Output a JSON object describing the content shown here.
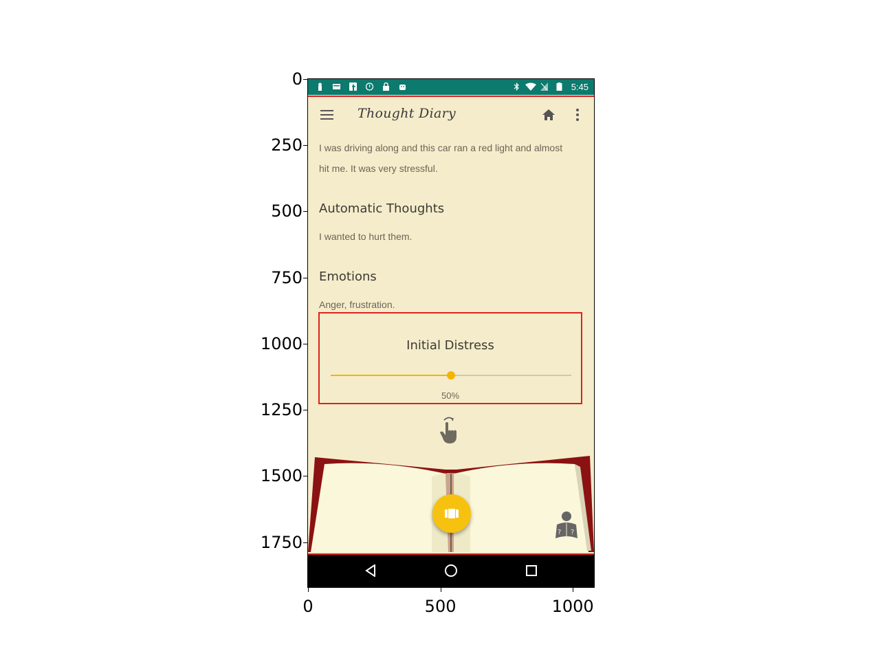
{
  "status_bar": {
    "time": "5:45",
    "color": "#0d7a6e"
  },
  "app_bar": {
    "title": "Thought Diary",
    "menu_icon": "hamburger-icon",
    "home_icon": "home-icon",
    "more_icon": "more-vert-icon"
  },
  "entry": {
    "situation": "I was driving along and this car ran a red light and almost hit me. It was very stressful.",
    "automatic_thoughts_heading": "Automatic Thoughts",
    "automatic_thoughts": "I wanted to hurt them.",
    "emotions_heading": "Emotions",
    "emotions": "Anger, frustration."
  },
  "initial_distress": {
    "label": "Initial Distress",
    "value_text": "50%",
    "value": 0.5,
    "accent": "#f4b400"
  },
  "fab": {
    "icon": "theater-icon",
    "color": "#f7c20f"
  },
  "reader_icon": "reader-question-icon",
  "axis": {
    "y_ticks": [
      "0",
      "250",
      "500",
      "750",
      "1000",
      "1250",
      "1500",
      "1750"
    ],
    "x_ticks": [
      "0",
      "500",
      "1000"
    ]
  }
}
